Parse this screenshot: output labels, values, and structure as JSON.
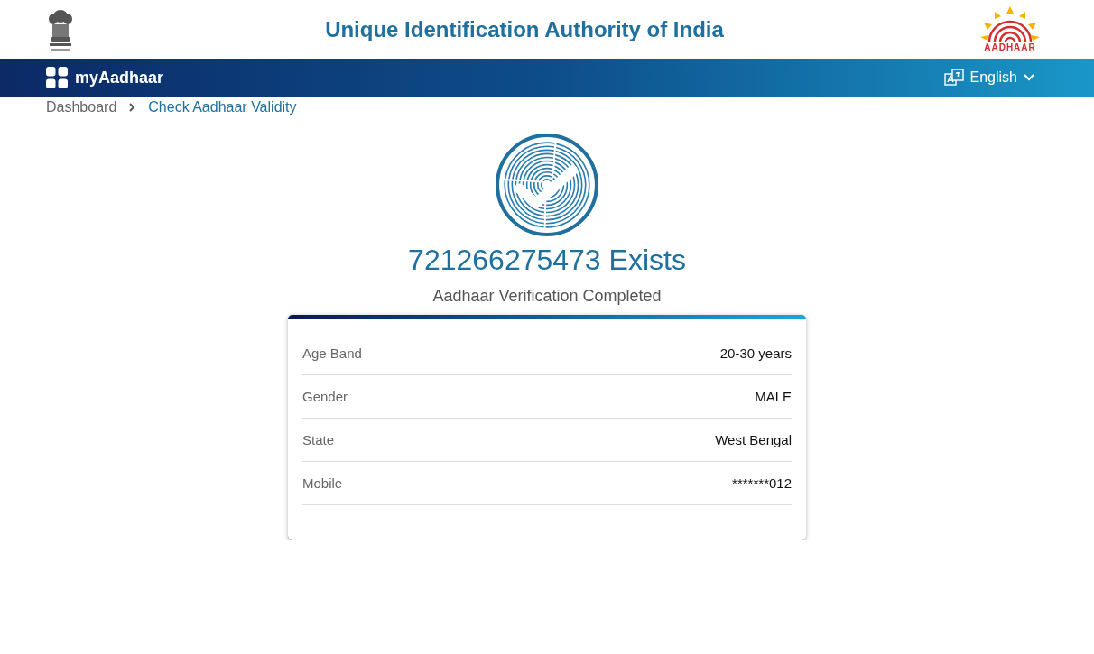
{
  "header": {
    "title": "Unique Identification Authority of India",
    "logo_text": "AADHAAR"
  },
  "navbar": {
    "brand": "myAadhaar",
    "language": "English"
  },
  "breadcrumb": [
    {
      "label": "Dashboard",
      "selected": false
    },
    {
      "label": "Check Aadhaar Validity",
      "selected": true
    }
  ],
  "result": {
    "heading": "721266275473 Exists",
    "subheading": "Aadhaar Verification Completed"
  },
  "details": [
    {
      "label": "Age Band",
      "value": "20-30 years"
    },
    {
      "label": "Gender",
      "value": "MALE"
    },
    {
      "label": "State",
      "value": "West Bengal"
    },
    {
      "label": "Mobile",
      "value": "*******012"
    }
  ]
}
